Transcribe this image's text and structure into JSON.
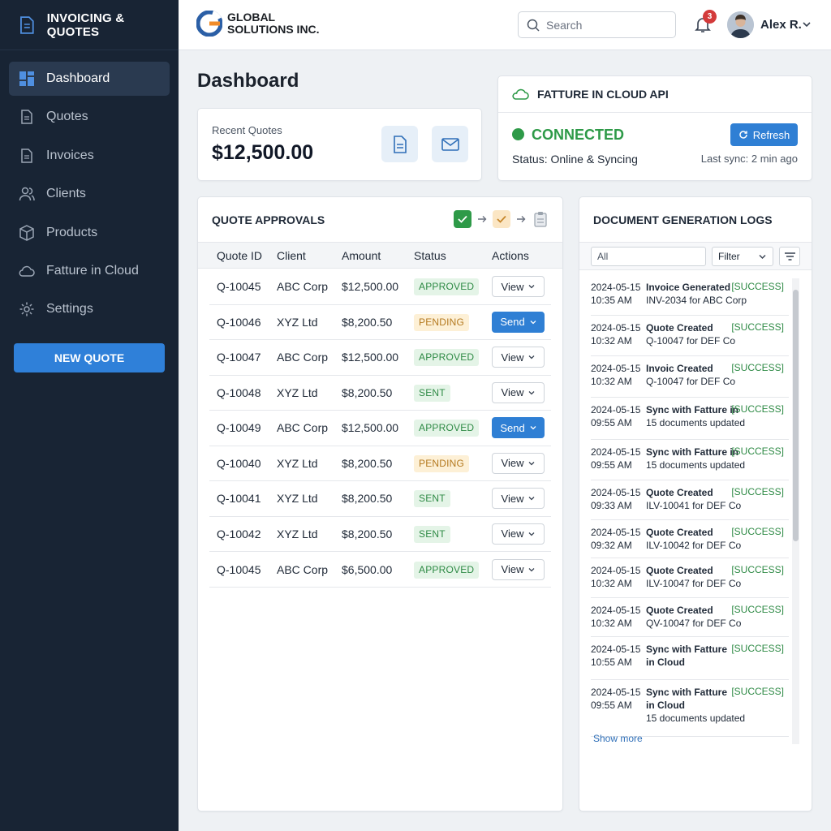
{
  "app": {
    "title": "INVOICING & QUOTES"
  },
  "sidebar": {
    "items": [
      {
        "label": "Dashboard",
        "icon": "dashboard-icon",
        "active": true
      },
      {
        "label": "Quotes",
        "icon": "document-icon"
      },
      {
        "label": "Invoices",
        "icon": "document-icon"
      },
      {
        "label": "Clients",
        "icon": "users-icon"
      },
      {
        "label": "Products",
        "icon": "box-icon"
      },
      {
        "label": "Fatture in Cloud",
        "icon": "cloud-icon"
      },
      {
        "label": "Settings",
        "icon": "gear-icon"
      }
    ],
    "new_quote_label": "NEW QUOTE"
  },
  "header": {
    "logo_line1": "GLOBAL",
    "logo_line2": "SOLUTIONS INC.",
    "search_placeholder": "Search",
    "notification_count": "3",
    "user_name": "Alex R."
  },
  "page": {
    "title": "Dashboard"
  },
  "recent_quotes": {
    "label": "Recent Quotes",
    "value": "$12,500.00"
  },
  "api": {
    "title": "FATTURE IN CLOUD API",
    "connection": "CONNECTED",
    "status": "Status: Online & Syncing",
    "refresh_label": "Refresh",
    "last_sync": "Last sync: 2 min ago",
    "colors": {
      "connected": "#2e9a48",
      "accent": "#2f7fd4"
    }
  },
  "approvals": {
    "title": "QUOTE APPROVALS",
    "columns": [
      "Quote ID",
      "Client",
      "Amount",
      "Status",
      "Actions"
    ],
    "rows": [
      {
        "id": "Q-10045",
        "client": "ABC Corp",
        "amount": "$12,500.00",
        "status": "APPROVED",
        "action": "View"
      },
      {
        "id": "Q-10046",
        "client": "XYZ Ltd",
        "amount": "$8,200.50",
        "status": "PENDING",
        "action": "Send"
      },
      {
        "id": "Q-10047",
        "client": "ABC Corp",
        "amount": "$12,500.00",
        "status": "APPROVED",
        "action": "View"
      },
      {
        "id": "Q-10048",
        "client": "XYZ Ltd",
        "amount": "$8,200.50",
        "status": "SENT",
        "action": "View"
      },
      {
        "id": "Q-10049",
        "client": "ABC Corp",
        "amount": "$12,500.00",
        "status": "APPROVED",
        "action": "Send"
      },
      {
        "id": "Q-10040",
        "client": "XYZ Ltd",
        "amount": "$8,200.50",
        "status": "PENDING",
        "action": "View"
      },
      {
        "id": "Q-10041",
        "client": "XYZ Ltd",
        "amount": "$8,200.50",
        "status": "SENT",
        "action": "View"
      },
      {
        "id": "Q-10042",
        "client": "XYZ Ltd",
        "amount": "$8,200.50",
        "status": "SENT",
        "action": "View"
      },
      {
        "id": "Q-10045",
        "client": "ABC Corp",
        "amount": "$6,500.00",
        "status": "APPROVED",
        "action": "View"
      }
    ]
  },
  "logs": {
    "title": "DOCUMENT GENERATION LOGS",
    "filter_all": "All",
    "filter_label": "Filter",
    "show_more": "Show more",
    "entries": [
      {
        "date": "2024-05-15",
        "time": "10:35 AM",
        "title": "Invoice Generated",
        "detail": "INV-2034 for ABC Corp",
        "status": "[SUCCESS]"
      },
      {
        "date": "2024-05-15",
        "time": "10:32 AM",
        "title": "Quote Created",
        "detail": "Q-10047 for DEF Co",
        "status": "[SUCCESS]"
      },
      {
        "date": "2024-05-15",
        "time": "10:32 AM",
        "title": "Invoic Created",
        "detail": "Q-10047 for DEF Co",
        "status": "[SUCCESS]"
      },
      {
        "date": "2024-05-15",
        "time": "09:55 AM",
        "title": "Sync with Fatture in",
        "detail": "15 documents updated",
        "status": "[SUCCESS]"
      },
      {
        "date": "2024-05-15",
        "time": "09:55 AM",
        "title": "Sync with Fatture in",
        "detail": "15 documents updated",
        "status": "[SUCCESS]"
      },
      {
        "date": "2024-05-15",
        "time": "09:33 AM",
        "title": "Quote Created",
        "detail": "ILV-10041 for DEF Co",
        "status": "[SUCCESS]"
      },
      {
        "date": "2024-05-15",
        "time": "09:32 AM",
        "title": "Quote Created",
        "detail": "ILV-10042 for DEF Co",
        "status": "[SUCCESS]"
      },
      {
        "date": "2024-05-15",
        "time": "10:32 AM",
        "title": "Quote Created",
        "detail": "ILV-10047 for DEF Co",
        "status": "[SUCCESS]"
      },
      {
        "date": "2024-05-15",
        "time": "10:32 AM",
        "title": "Quote Created",
        "detail": "QV-10047 for DEF Co",
        "status": "[SUCCESS]"
      },
      {
        "date": "2024-05-15",
        "time": "10:55 AM",
        "title": "Sync with Fatture",
        "title2": "in Cloud",
        "detail": "",
        "status": "[SUCCESS]"
      },
      {
        "date": "2024-05-15",
        "time": "09:55 AM",
        "title": "Sync with Fatture",
        "title2": "in Cloud",
        "detail": "15 documents updated",
        "status": "[SUCCESS]"
      }
    ]
  }
}
